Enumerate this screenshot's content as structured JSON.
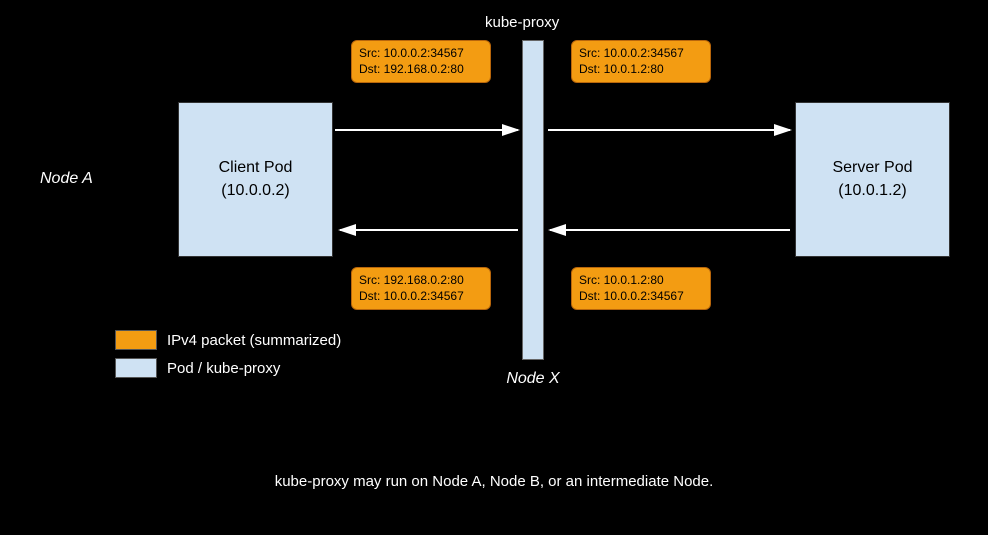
{
  "client_pod": {
    "title": "Client Pod",
    "ip": "(10.0.0.2)"
  },
  "server_pod": {
    "title": "Server Pod",
    "ip": "(10.0.1.2)"
  },
  "kube_proxy_label": "kube-proxy",
  "host_a": "Node A",
  "host_x": "Node X",
  "packets": {
    "p1": {
      "src": "Src: 10.0.0.2:34567",
      "dst": "Dst: 192.168.0.2:80"
    },
    "p2": {
      "src": "Src: 10.0.0.2:34567",
      "dst": "Dst: 10.0.1.2:80"
    },
    "p3": {
      "src": "Src: 192.168.0.2:80",
      "dst": "Dst: 10.0.0.2:34567"
    },
    "p4": {
      "src": "Src: 10.0.1.2:80",
      "dst": "Dst: 10.0.0.2:34567"
    }
  },
  "legend": {
    "orange": "IPv4 packet (summarized)",
    "blue": "Pod / kube-proxy"
  },
  "footnote": "kube-proxy may run on Node A, Node B, or an intermediate Node."
}
